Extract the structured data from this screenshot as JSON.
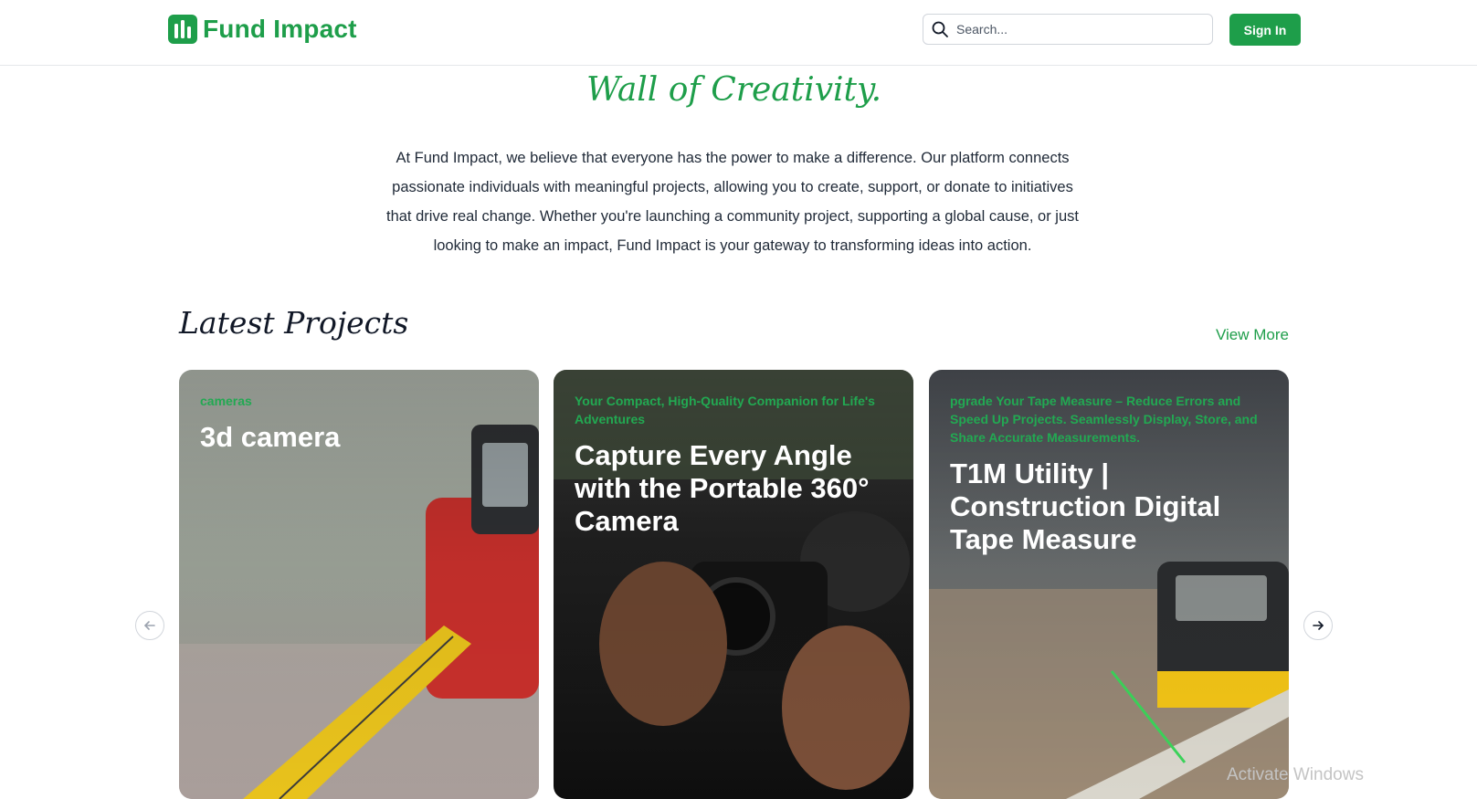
{
  "header": {
    "brand": "Fund Impact",
    "search_placeholder": "Search...",
    "signin_label": "Sign In"
  },
  "hero": {
    "title": "Wall of Creativity.",
    "text": "At Fund Impact, we believe that everyone has the power to make a difference. Our platform connects passionate individuals with meaningful projects, allowing you to create, support, or donate to initiatives that drive real change. Whether you're launching a community project, supporting a global cause, or just looking to make an impact, Fund Impact is your gateway to transforming ideas into action."
  },
  "latest": {
    "title": "Latest Projects",
    "view_more": "View More",
    "cards": [
      {
        "category": "cameras",
        "title": "3d camera"
      },
      {
        "category": "Your Compact, High-Quality Companion for Life's Adventures",
        "title": "Capture Every Angle with the Portable 360° Camera"
      },
      {
        "category": "pgrade Your Tape Measure – Reduce Errors and Speed Up Projects. Seamlessly Display, Store, and Share Accurate Measurements.",
        "title": "T1M Utility | Construction Digital Tape Measure"
      }
    ]
  },
  "colors": {
    "brand_green": "#1e9e4a",
    "category_green": "#22a952"
  },
  "icons": {
    "logo": "bar-chart-logo-icon",
    "search": "search-icon",
    "prev": "arrow-left-icon",
    "next": "arrow-right-icon"
  },
  "overlay": {
    "watermark": "Activate Windows"
  }
}
